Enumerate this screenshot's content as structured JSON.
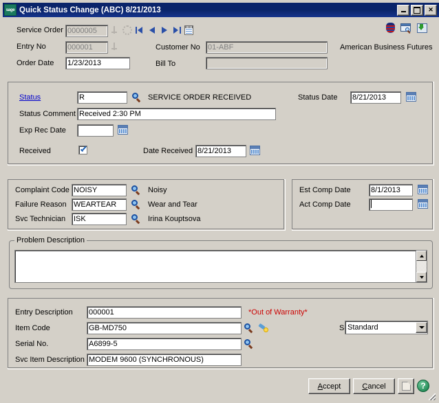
{
  "window": {
    "title": "Quick Status Change (ABC) 8/21/2013",
    "logo_text": "sage",
    "minimize_label": "_",
    "maximize_label": "",
    "close_label": "✕",
    "titlebar_color": "#0a246a",
    "face_color": "#d4d0c8"
  },
  "header": {
    "service_order_label": "Service Order",
    "service_order_value": "0000005",
    "entry_no_label": "Entry No",
    "entry_no_value": "000001",
    "order_date_label": "Order Date",
    "order_date_value": "1/23/2013",
    "customer_no_label": "Customer No",
    "customer_no_value": "01-ABF",
    "bill_to_label": "Bill To",
    "bill_to_value": "",
    "customer_name": "American Business Futures",
    "nav": {
      "first": "first-record",
      "prev": "previous-record",
      "next": "next-record",
      "last": "last-record",
      "memo": "memo"
    },
    "toolbar_icons": [
      "customer-badge-icon",
      "inquiry-window-icon",
      "drill-down-icon"
    ]
  },
  "status_panel": {
    "status_label": "Status",
    "status_value": "R",
    "status_description": "SERVICE ORDER RECEIVED",
    "status_date_label": "Status Date",
    "status_date_value": "8/21/2013",
    "status_comment_label": "Status Comment",
    "status_comment_value": "Received 2:30 PM",
    "exp_rec_date_label": "Exp Rec Date",
    "exp_rec_date_value": "",
    "received_label": "Received",
    "received_checked": true,
    "date_received_label": "Date Received",
    "date_received_value": "8/21/2013"
  },
  "complaint_panel": {
    "complaint_code_label": "Complaint Code",
    "complaint_code_value": "NOISY",
    "complaint_code_description": "Noisy",
    "failure_reason_label": "Failure Reason",
    "failure_reason_value": "WEARTEAR",
    "failure_reason_description": "Wear and Tear",
    "svc_technician_label": "Svc Technician",
    "svc_technician_value": "ISK",
    "svc_technician_description": "Irina Kouptsova"
  },
  "comp_date_panel": {
    "est_comp_date_label": "Est Comp Date",
    "est_comp_date_value": "8/1/2013",
    "act_comp_date_label": "Act Comp Date",
    "act_comp_date_value": ""
  },
  "problem_description": {
    "group_title": "Problem Description",
    "value": ""
  },
  "item_panel": {
    "entry_description_label": "Entry Description",
    "entry_description_value": "000001",
    "warranty_note": "*Out of Warranty*",
    "warranty_color": "#cc0000",
    "item_code_label": "Item Code",
    "item_code_value": "GB-MD750",
    "serial_no_label": "Serial No.",
    "serial_no_value": "A6899-5",
    "svc_item_description_label": "Svc Item Description",
    "svc_item_description_value": "MODEM 9600 (SYNCHRONOUS)",
    "service_type_label": "Service Type",
    "service_type_value": "Standard"
  },
  "footer": {
    "accept_label": "Accept",
    "accept_accel": "A",
    "cancel_label": "Cancel",
    "cancel_accel": "C",
    "print_label": "print-preview",
    "help_label": "?"
  }
}
